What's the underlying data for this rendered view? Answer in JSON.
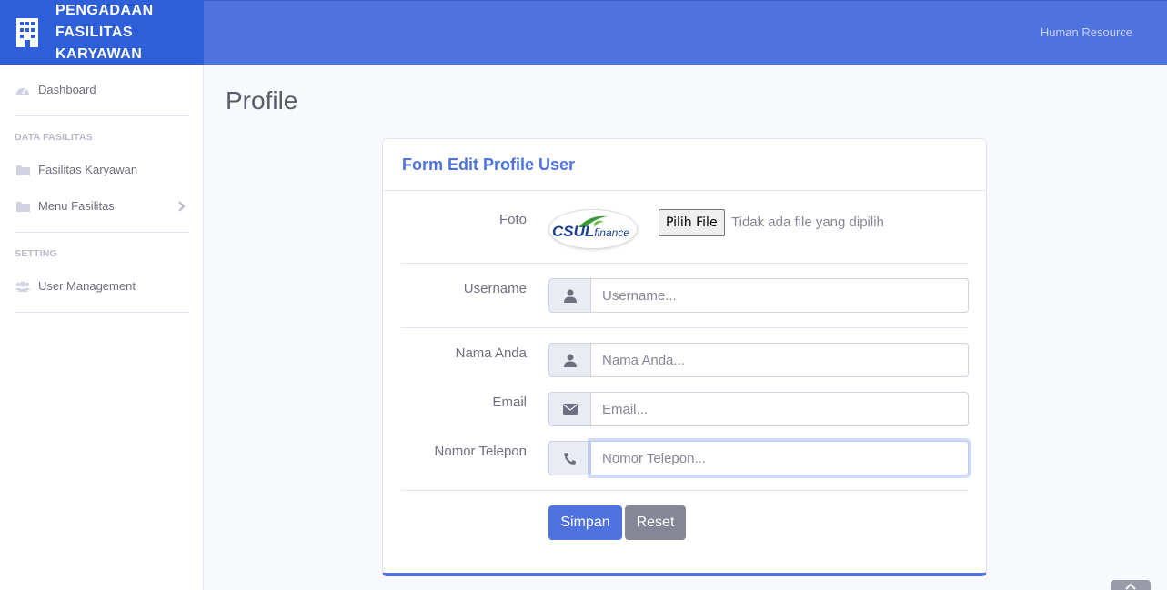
{
  "brand": {
    "lines": [
      "PENGADAAN",
      "FASILITAS",
      "KARYAWAN"
    ],
    "icon": "building-icon"
  },
  "topbar": {
    "user_label": "Human Resource"
  },
  "sidebar": {
    "dashboard": "Dashboard",
    "heading_data": "DATA FASILITAS",
    "fasilitas_karyawan": "Fasilitas Karyawan",
    "menu_fasilitas": "Menu Fasilitas",
    "heading_setting": "SETTING",
    "user_management": "User Management"
  },
  "page": {
    "title": "Profile"
  },
  "form": {
    "title": "Form Edit Profile User",
    "foto_label": "Foto",
    "logo_text_main": "CSUL",
    "logo_text_sub": "finance",
    "file_button": "Pilih File",
    "file_note": "Tidak ada file yang dipilih",
    "username_label": "Username",
    "username_placeholder": "Username...",
    "nama_label": "Nama Anda",
    "nama_placeholder": "Nama Anda...",
    "email_label": "Email",
    "email_placeholder": "Email...",
    "telepon_label": "Nomor Telepon",
    "telepon_placeholder": "Nomor Telepon...",
    "save_button": "Simpan",
    "reset_button": "Reset"
  },
  "colors": {
    "primary": "#4e73df",
    "brand_bg": "#2f5fd8",
    "secondary": "#858796"
  }
}
